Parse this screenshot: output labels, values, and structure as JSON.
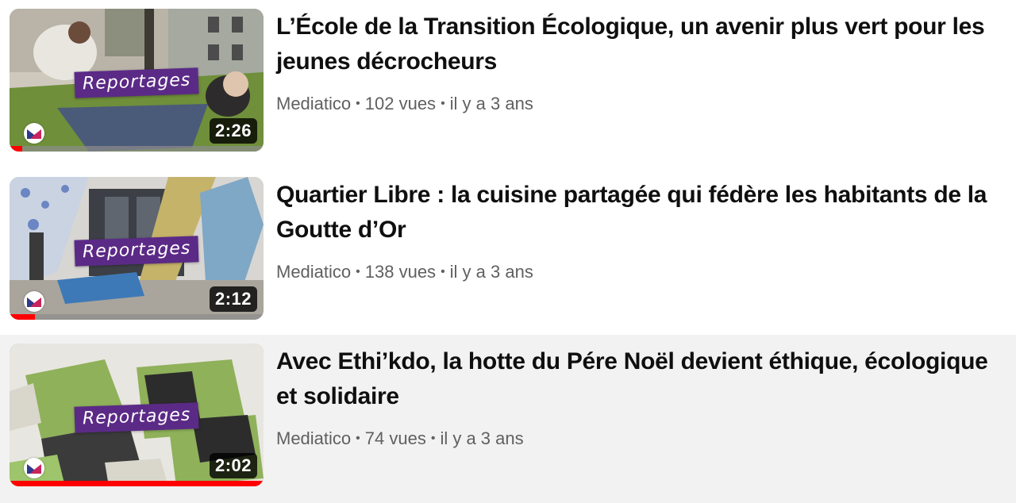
{
  "videos": [
    {
      "title": "L’École de la Transition Écologique, un avenir plus vert pour les jeunes décrocheurs",
      "channel": "Mediatico",
      "views": "102 vues",
      "age": "il y a 3 ans",
      "duration": "2:26",
      "badge": "Reportages",
      "watched_fraction": 0.05
    },
    {
      "title": "Quartier Libre : la cuisine partagée qui fédère les habitants de la Goutte d’Or",
      "channel": "Mediatico",
      "views": "138 vues",
      "age": "il y a 3 ans",
      "duration": "2:12",
      "badge": "Reportages",
      "watched_fraction": 0.1
    },
    {
      "title": "Avec Ethi’kdo, la hotte du Pére Noël devient éthique, écologique et solidaire",
      "channel": "Mediatico",
      "views": "74 vues",
      "age": "il y a 3 ans",
      "duration": "2:02",
      "badge": "Reportages",
      "watched_fraction": 1.0
    }
  ],
  "colors": {
    "progress": "#ff0000",
    "badge": "#5b2a86",
    "hover_row": "#f2f2f2"
  },
  "icons": {
    "channel_logo": "mediatico-logo-icon",
    "separator": "dot-separator"
  }
}
